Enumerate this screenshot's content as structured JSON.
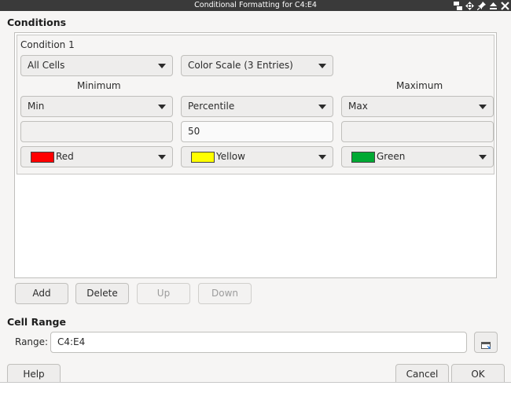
{
  "window": {
    "title": "Conditional Formatting for C4:E4"
  },
  "conditions": {
    "heading": "Conditions",
    "condition_label": "Condition 1",
    "apply_to": "All Cells",
    "type": "Color Scale (3 Entries)",
    "minimum_label": "Minimum",
    "maximum_label": "Maximum",
    "min": {
      "type": "Min",
      "value": "",
      "color_name": "Red",
      "color": "#ff0000"
    },
    "mid": {
      "type": "Percentile",
      "value": "50",
      "color_name": "Yellow",
      "color": "#ffff00"
    },
    "max": {
      "type": "Max",
      "value": "",
      "color_name": "Green",
      "color": "#00a933"
    }
  },
  "buttons": {
    "add": "Add",
    "delete": "Delete",
    "up": "Up",
    "down": "Down"
  },
  "cell_range": {
    "heading": "Cell Range",
    "label": "Range:",
    "value": "C4:E4"
  },
  "footer": {
    "help": "Help",
    "cancel": "Cancel",
    "ok": "OK"
  }
}
